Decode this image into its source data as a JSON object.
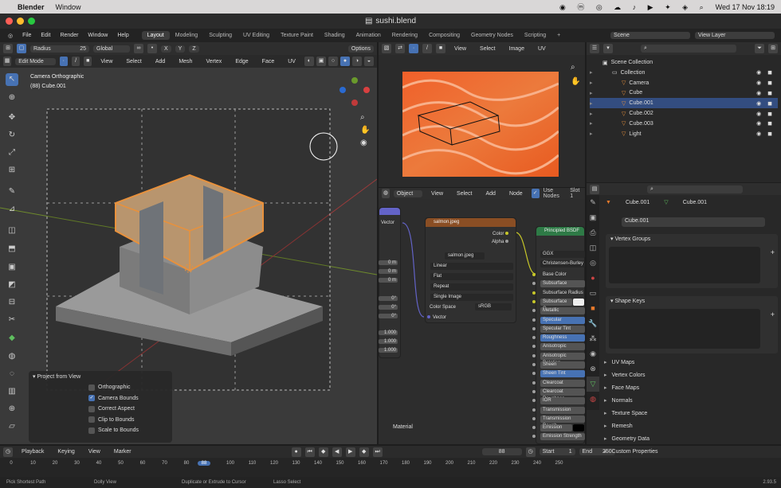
{
  "mac": {
    "app": "Blender",
    "menu": "Window",
    "datetime": "Wed 17 Nov  18:19"
  },
  "title": "sushi.blend",
  "menus": [
    "File",
    "Edit",
    "Render",
    "Window",
    "Help"
  ],
  "workspaces": [
    "Layout",
    "Modeling",
    "Sculpting",
    "UV Editing",
    "Texture Paint",
    "Shading",
    "Animation",
    "Rendering",
    "Compositing",
    "Geometry Nodes",
    "Scripting"
  ],
  "scene": {
    "label": "Scene",
    "view_layer": "View Layer"
  },
  "viewport": {
    "mode": "Edit Mode",
    "menus": [
      "View",
      "Select",
      "Add",
      "Mesh",
      "Vertex",
      "Edge",
      "Face",
      "UV"
    ],
    "radius_label": "Radius",
    "radius_value": "25",
    "orientation": "Global",
    "options": "Options",
    "overlay_title": "Camera Orthographic",
    "overlay_sub": "(88) Cube.001",
    "axes": [
      "X",
      "Y",
      "Z"
    ]
  },
  "operator_panel": {
    "title": "Project from View",
    "options": [
      {
        "label": "Orthographic",
        "checked": false
      },
      {
        "label": "Camera Bounds",
        "checked": true
      },
      {
        "label": "Correct Aspect",
        "checked": false
      },
      {
        "label": "Clip to Bounds",
        "checked": false
      },
      {
        "label": "Scale to Bounds",
        "checked": false
      }
    ]
  },
  "uv_editor": {
    "menus": [
      "View",
      "Select",
      "Image",
      "UV"
    ]
  },
  "node_editor": {
    "type": "Object",
    "menus": [
      "View",
      "Select",
      "Add",
      "Node"
    ],
    "use_nodes": "Use Nodes",
    "slot": "Slot 1",
    "material": "Material",
    "image_node": {
      "title": "salmon.jpeg",
      "outputs": [
        "Color",
        "Alpha"
      ],
      "image": "salmon.jpeg",
      "interp": "Linear",
      "proj": "Flat",
      "ext": "Repeat",
      "source": "Single Image",
      "cs_label": "Color Space",
      "cs_value": "sRGB",
      "input": "Vector"
    },
    "left_node": {
      "vector": "Vector",
      "values": [
        "0 m",
        "0 m",
        "0 m",
        "0°",
        "0°",
        "0°",
        "1.000",
        "1.000",
        "1.000"
      ]
    },
    "bsdf": {
      "title": "Principled BSDF",
      "dist": "GGX",
      "sss": "Christensen-Burley",
      "rows": [
        {
          "label": "Base Color",
          "style": "none"
        },
        {
          "label": "Subsurface",
          "style": "grey"
        },
        {
          "label": "Subsurface Radius",
          "style": "none"
        },
        {
          "label": "Subsurface C...",
          "style": "swatch"
        },
        {
          "label": "Metallic",
          "style": "grey"
        },
        {
          "label": "Specular",
          "style": "blue"
        },
        {
          "label": "Specular Tint",
          "style": "grey"
        },
        {
          "label": "Roughness",
          "style": "blue"
        },
        {
          "label": "Anisotropic",
          "style": "grey"
        },
        {
          "label": "Anisotropic Rotation",
          "style": "grey"
        },
        {
          "label": "Sheen",
          "style": "grey"
        },
        {
          "label": "Sheen Tint",
          "style": "blue"
        },
        {
          "label": "Clearcoat",
          "style": "grey"
        },
        {
          "label": "Clearcoat Roughnes",
          "style": "grey"
        },
        {
          "label": "IOR",
          "style": "grey"
        },
        {
          "label": "Transmission",
          "style": "grey"
        },
        {
          "label": "Transmission Rough",
          "style": "grey"
        },
        {
          "label": "Emission",
          "style": "black"
        },
        {
          "label": "Emission Strength",
          "style": "grey"
        }
      ]
    }
  },
  "outliner": {
    "items": [
      {
        "label": "Scene Collection",
        "indent": 0
      },
      {
        "label": "Collection",
        "indent": 1
      },
      {
        "label": "Camera",
        "indent": 2
      },
      {
        "label": "Cube",
        "indent": 2
      },
      {
        "label": "Cube.001",
        "indent": 2,
        "selected": true
      },
      {
        "label": "Cube.002",
        "indent": 2
      },
      {
        "label": "Cube.003",
        "indent": 2
      },
      {
        "label": "Light",
        "indent": 2
      }
    ]
  },
  "properties": {
    "breadcrumb": [
      "Cube.001",
      "Cube.001"
    ],
    "mesh_name": "Cube.001",
    "open_sections": [
      "Vertex Groups",
      "Shape Keys"
    ],
    "sections": [
      "UV Maps",
      "Vertex Colors",
      "Face Maps",
      "Normals",
      "Texture Space",
      "Remesh",
      "Geometry Data",
      "Custom Properties"
    ]
  },
  "timeline": {
    "menus": [
      "Playback",
      "Keying",
      "View",
      "Marker"
    ],
    "current": "88",
    "start_label": "Start",
    "start": "1",
    "end_label": "End",
    "end": "250",
    "ticks": [
      "0",
      "10",
      "20",
      "30",
      "40",
      "50",
      "60",
      "70",
      "80",
      "88",
      "100",
      "110",
      "120",
      "130",
      "140",
      "150",
      "160",
      "170",
      "180",
      "190",
      "200",
      "210",
      "220",
      "230",
      "240",
      "250"
    ]
  },
  "status": {
    "items": [
      "Pick Shortest Path",
      "Dolly View",
      "Duplicate or Extrude to Cursor",
      "Lasso Select"
    ],
    "version": "2.93.5"
  },
  "colors": {
    "accent": "#4772b3",
    "orange": "#e87a2b",
    "edit_orange": "#d8884a"
  }
}
